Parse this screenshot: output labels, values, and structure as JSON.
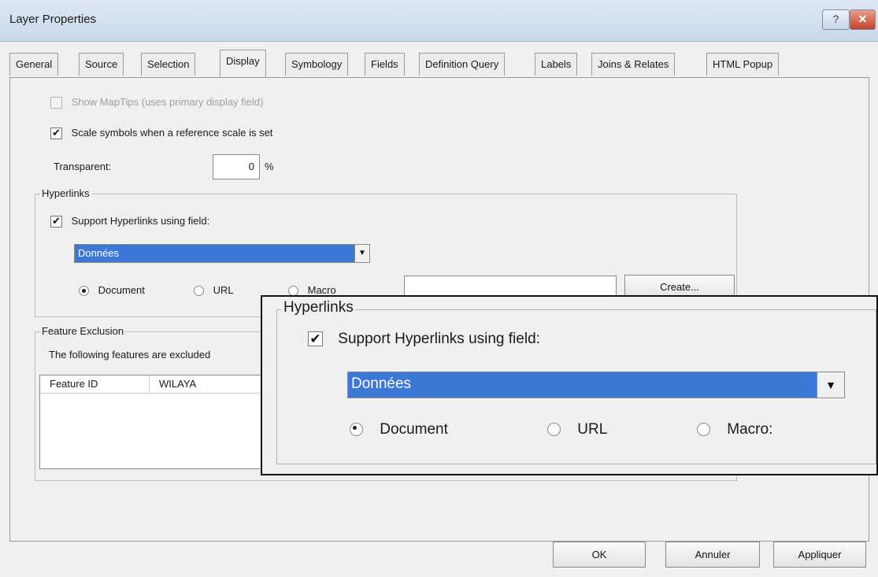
{
  "window": {
    "title": "Layer Properties",
    "help_label": "?",
    "close_label": "✕"
  },
  "tabs": [
    {
      "label": "General",
      "active": false
    },
    {
      "label": "Source",
      "active": false
    },
    {
      "label": "Selection",
      "active": false
    },
    {
      "label": "Display",
      "active": true
    },
    {
      "label": "Symbology",
      "active": false
    },
    {
      "label": "Fields",
      "active": false
    },
    {
      "label": "Definition Query",
      "active": false
    },
    {
      "label": "Labels",
      "active": false
    },
    {
      "label": "Joins & Relates",
      "active": false
    },
    {
      "label": "HTML Popup",
      "active": false
    }
  ],
  "display": {
    "show_maptips_label": "Show MapTips (uses primary display field)",
    "show_maptips_checked": false,
    "scale_symbols_label": "Scale symbols when a reference scale is set",
    "scale_symbols_checked": true,
    "transparent_label": "Transparent:",
    "transparent_value": "0",
    "transparent_unit": "%"
  },
  "hyperlinks": {
    "group_title": "Hyperlinks",
    "support_label": "Support Hyperlinks using field:",
    "support_checked": true,
    "field_value": "Données",
    "dropdown_arrow": "▼",
    "radios": [
      {
        "label": "Document",
        "selected": true
      },
      {
        "label": "URL",
        "selected": false
      },
      {
        "label": "Macro:",
        "selected": false
      }
    ],
    "main_radio_labels": [
      "Document",
      "URL",
      "Macro"
    ],
    "macro_value": "",
    "create_button": "Create..."
  },
  "feature_exclusion": {
    "group_title": "Feature Exclusion",
    "description": "The following features are excluded",
    "columns": [
      "Feature ID",
      "WILAYA"
    ]
  },
  "footer": {
    "ok": "OK",
    "cancel": "Annuler",
    "apply": "Appliquer"
  },
  "check_mark": "✔"
}
